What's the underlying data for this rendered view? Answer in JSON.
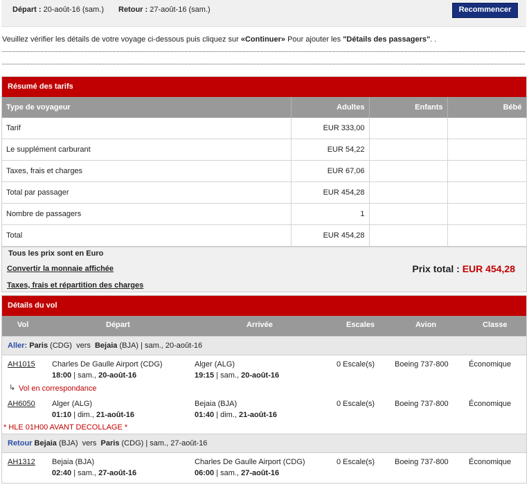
{
  "header": {
    "depart_label": "Départ :",
    "depart_value": "20-août-16 (sam.)",
    "retour_label": "Retour :",
    "retour_value": "27-août-16 (sam.)",
    "restart_button": "Recommencer"
  },
  "instruction": {
    "part1": "Veuillez vérifier les détails de votre voyage ci-dessous puis cliquez sur ",
    "continue": "«Continuer»",
    "part2": " Pour ajouter les ",
    "details": "\"Détails des passagers\"",
    "part3": ". ."
  },
  "fares": {
    "title": "Résumé des tarifs",
    "headers": [
      "Type de voyageur",
      "Adultes",
      "Enfants",
      "Bébé"
    ],
    "rows": [
      {
        "label": "Tarif",
        "adultes": "EUR 333,00"
      },
      {
        "label": "Le supplément carburant",
        "adultes": "EUR 54,22"
      },
      {
        "label": "Taxes, frais et charges",
        "adultes": "EUR 67,06"
      },
      {
        "label": "Total par passager",
        "adultes": "EUR 454,28"
      },
      {
        "label": "Nombre de passagers",
        "adultes": "1"
      },
      {
        "label": "Total",
        "adultes": "EUR 454,28"
      }
    ],
    "note": "Tous les prix sont en Euro",
    "convert_link": "Convertir la monnaie affichée",
    "tax_link": "Taxes, frais et répartition des charges",
    "total_label": "Prix total :",
    "total_value": "EUR 454,28"
  },
  "flights": {
    "title": "Détails du vol",
    "headers": {
      "vol": "Vol",
      "depart": "Départ",
      "arrivee": "Arrivée",
      "escales": "Escales",
      "avion": "Avion",
      "classe": "Classe"
    },
    "aller": {
      "label": "Aller:",
      "from_city": "Paris",
      "from_code": "(CDG)",
      "vers": "vers",
      "to_city": "Bejaia",
      "to_code": "(BJA)",
      "date": "| sam., 20-août-16"
    },
    "seg1": {
      "flight": "AH1015",
      "from": "Charles De Gaulle Airport (CDG)",
      "dep_time": "18:00",
      "dep_day": "| sam.,",
      "dep_date": "20-août-16",
      "to": "Alger (ALG)",
      "arr_time": "19:15",
      "arr_day": "| sam.,",
      "arr_date": "20-août-16",
      "stops": "0 Escale(s)",
      "aircraft": "Boeing 737-800",
      "class": "Économique"
    },
    "connection": "Vol en correspondance",
    "seg2": {
      "flight": "AH6050",
      "from": "Alger (ALG)",
      "dep_time": "01:10",
      "dep_day": "| dim.,",
      "dep_date": "21-août-16",
      "to": "Bejaia (BJA)",
      "arr_time": "01:40",
      "arr_day": "| dim.,",
      "arr_date": "21-août-16",
      "stops": "0 Escale(s)",
      "aircraft": "Boeing 737-800",
      "class": "Économique"
    },
    "hle_note": "* HLE 01H00 AVANT DECOLLAGE *",
    "retour": {
      "label": "Retour",
      "from_city": "Bejaia",
      "from_code": "(BJA)",
      "vers": "vers",
      "to_city": "Paris",
      "to_code": "(CDG)",
      "date": "| sam., 27-août-16"
    },
    "seg3": {
      "flight": "AH1312",
      "from": "Bejaia (BJA)",
      "dep_time": "02:40",
      "dep_day": "| sam.,",
      "dep_date": "27-août-16",
      "to": "Charles De Gaulle Airport (CDG)",
      "arr_time": "06:00",
      "arr_day": "| sam.,",
      "arr_date": "27-août-16",
      "stops": "0 Escale(s)",
      "aircraft": "Boeing 737-800",
      "class": "Économique"
    }
  }
}
